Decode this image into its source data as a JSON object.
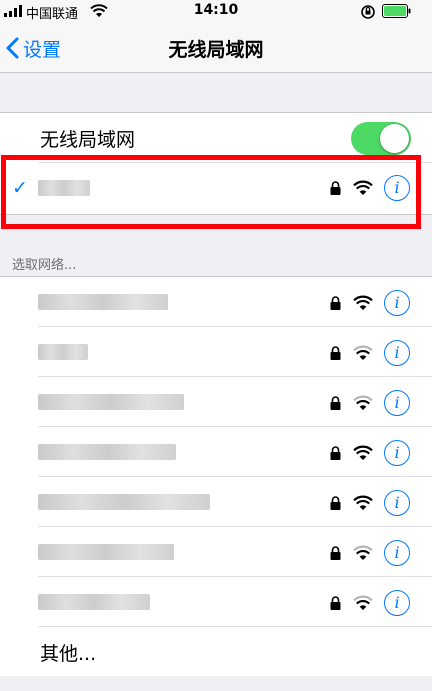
{
  "status_bar": {
    "carrier": "中国联通",
    "time": "14:10"
  },
  "nav": {
    "back_label": "设置",
    "title": "无线局域网"
  },
  "wifi_toggle": {
    "label": "无线局域网",
    "on": true
  },
  "connected_network": {
    "checkmark": "✓",
    "name_redacted": true
  },
  "section_header": "选取网络...",
  "networks": [
    {
      "name_redacted": true,
      "locked": true,
      "signal": 3
    },
    {
      "name_redacted": true,
      "locked": true,
      "signal": 2
    },
    {
      "name_redacted": true,
      "locked": true,
      "signal": 2
    },
    {
      "name_redacted": true,
      "locked": true,
      "signal": 3
    },
    {
      "name_redacted": true,
      "locked": true,
      "signal": 3
    },
    {
      "name_redacted": true,
      "locked": true,
      "signal": 2
    },
    {
      "name_redacted": true,
      "locked": true,
      "signal": 2
    }
  ],
  "other_label": "其他...",
  "info_glyph": "i",
  "colors": {
    "accent": "#007aff",
    "toggle_on": "#4cd964",
    "highlight": "#ff0008",
    "battery": "#4cd964"
  },
  "icons": {
    "signal": "cellular-signal-icon",
    "wifi": "wifi-icon",
    "lock": "lock-icon",
    "info": "info-icon",
    "battery": "battery-icon",
    "rotation_lock": "rotation-lock-icon",
    "back": "chevron-left-icon",
    "check": "checkmark-icon"
  }
}
